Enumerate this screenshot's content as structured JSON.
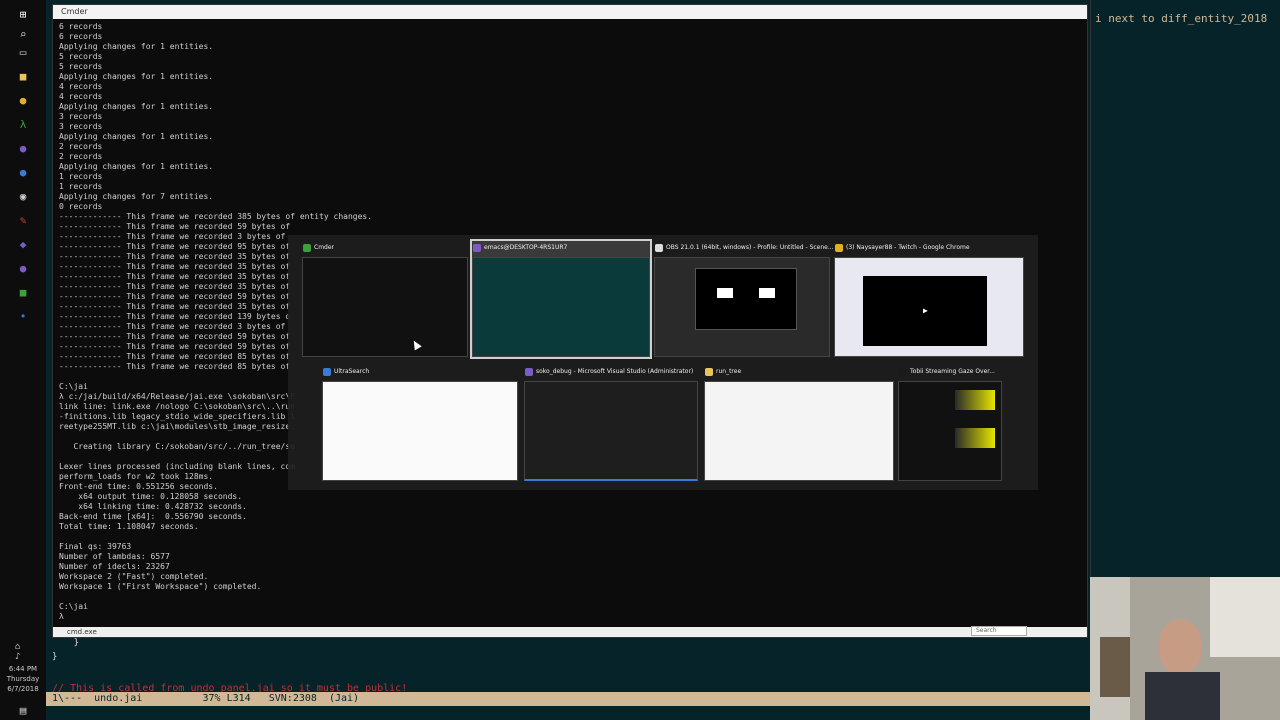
{
  "cmder": {
    "title": "Cmder",
    "lines": [
      "6 records",
      "6 records",
      "Applying changes for 1 entities.",
      "5 records",
      "5 records",
      "Applying changes for 1 entities.",
      "4 records",
      "4 records",
      "Applying changes for 1 entities.",
      "3 records",
      "3 records",
      "Applying changes for 1 entities.",
      "2 records",
      "2 records",
      "Applying changes for 1 entities.",
      "1 records",
      "1 records",
      "Applying changes for 7 entities.",
      "0 records",
      "------------- This frame we recorded 385 bytes of entity changes.",
      "------------- This frame we recorded 59 bytes of",
      "------------- This frame we recorded 3 bytes of",
      "------------- This frame we recorded 95 bytes of",
      "------------- This frame we recorded 35 bytes of",
      "------------- This frame we recorded 35 bytes of",
      "------------- This frame we recorded 35 bytes of",
      "------------- This frame we recorded 35 bytes of",
      "------------- This frame we recorded 59 bytes of",
      "------------- This frame we recorded 35 bytes of",
      "------------- This frame we recorded 139 bytes o",
      "------------- This frame we recorded 3 bytes of",
      "------------- This frame we recorded 59 bytes of",
      "------------- This frame we recorded 59 bytes of",
      "------------- This frame we recorded 85 bytes of",
      "------------- This frame we recorded 85 bytes of",
      "",
      "C:\\jai",
      "λ c:/jai/build/x64/Release/jai.exe \\sokoban\\src\\F",
      "link line: link.exe /nologo C:\\sokoban\\src\\..\\run",
      "-finitions.lib legacy_stdio_wide_specifiers.lib l",
      "reetype255MT.lib c:\\jai\\modules\\stb_image_resize.",
      "",
      "   Creating library C:/sokoban/src/../run_tree/so",
      "",
      "Lexer lines processed (including blank lines, com",
      "perform_loads for w2 took 128ms.",
      "Front-end time: 0.551256 seconds.",
      "    x64 output time: 0.128058 seconds.",
      "    x64 linking time: 0.428732 seconds.",
      "Back-end time [x64]:  0.556790 seconds.",
      "Total time: 1.108047 seconds.",
      "",
      "Final qs: 39763",
      "Number of lambdas: 6577",
      "Number of idecls: 23267",
      "Workspace 2 (\"Fast\") completed.",
      "Workspace 1 (\"First Workspace\") completed.",
      "",
      "C:\\jai",
      "λ "
    ],
    "status_tab": "cmd.exe",
    "search_placeholder": "Search"
  },
  "emacs": {
    "code_lines": [
      "    }",
      "}"
    ],
    "comment": "// This is called from undo_panel.jai so it must be public!",
    "modeline": "1\\---  undo.jai          37% L314   SVN:2308  (Jai)",
    "right_text": "i next to diff_entity_2018"
  },
  "taskbar": {
    "time": "6:44 PM",
    "day": "Thursday",
    "date": "6/7/2018"
  },
  "switcher": {
    "windows": [
      {
        "title": "Cmder",
        "icon_color": "#3aa03a"
      },
      {
        "title": "emacs@DESKTOP-4RS1UR7",
        "icon_color": "#7b5cc6",
        "selected": true
      },
      {
        "title": "OBS 21.0.1 (64bit, windows) - Profile: Untitled - Scene...",
        "icon_color": "#dddddd"
      },
      {
        "title": "(3) Naysayer88 - Twitch - Google Chrome",
        "icon_color": "#e3b022"
      },
      {
        "title": "UltraSearch",
        "icon_color": "#3a7bd5"
      },
      {
        "title": "soko_debug - Microsoft Visual Studio (Administrator)",
        "icon_color": "#7b5cc6"
      },
      {
        "title": "run_tree",
        "icon_color": "#e8c45a"
      },
      {
        "title": "Tobii Streaming Gaze Over...",
        "icon_color": "#1a1a1a"
      }
    ]
  }
}
